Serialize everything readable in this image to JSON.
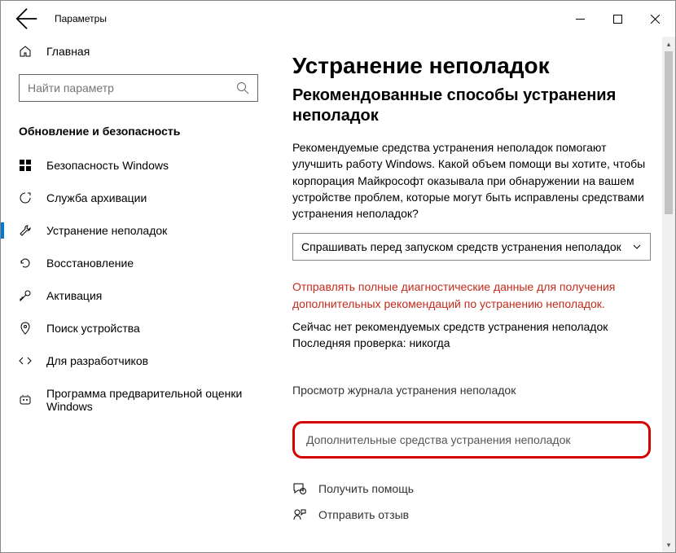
{
  "titlebar": {
    "title": "Параметры"
  },
  "sidebar": {
    "home": "Главная",
    "search_placeholder": "Найти параметр",
    "section": "Обновление и безопасность",
    "items": [
      {
        "label": "Безопасность Windows"
      },
      {
        "label": "Служба архивации"
      },
      {
        "label": "Устранение неполадок"
      },
      {
        "label": "Восстановление"
      },
      {
        "label": "Активация"
      },
      {
        "label": "Поиск устройства"
      },
      {
        "label": "Для разработчиков"
      },
      {
        "label": "Программа предварительной оценки Windows"
      }
    ]
  },
  "content": {
    "h1": "Устранение неполадок",
    "h2": "Рекомендованные способы устранения неполадок",
    "desc": "Рекомендуемые средства устранения неполадок помогают улучшить работу Windows. Какой объем помощи вы хотите, чтобы корпорация Майкрософт оказывала при обнаружении на вашем устройстве проблем, которые могут быть исправлены средствами устранения неполадок?",
    "dropdown": "Спрашивать перед запуском средств устранения неполадок",
    "warn": "Отправлять полные диагностические данные для получения дополнительных рекомендаций по устранению неполадок.",
    "status1": "Сейчас нет рекомендуемых средств устранения неполадок",
    "status2": "Последняя проверка: никогда",
    "link_history": "Просмотр журнала устранения неполадок",
    "link_additional": "Дополнительные средства устранения неполадок",
    "help": "Получить помощь",
    "feedback": "Отправить отзыв"
  }
}
